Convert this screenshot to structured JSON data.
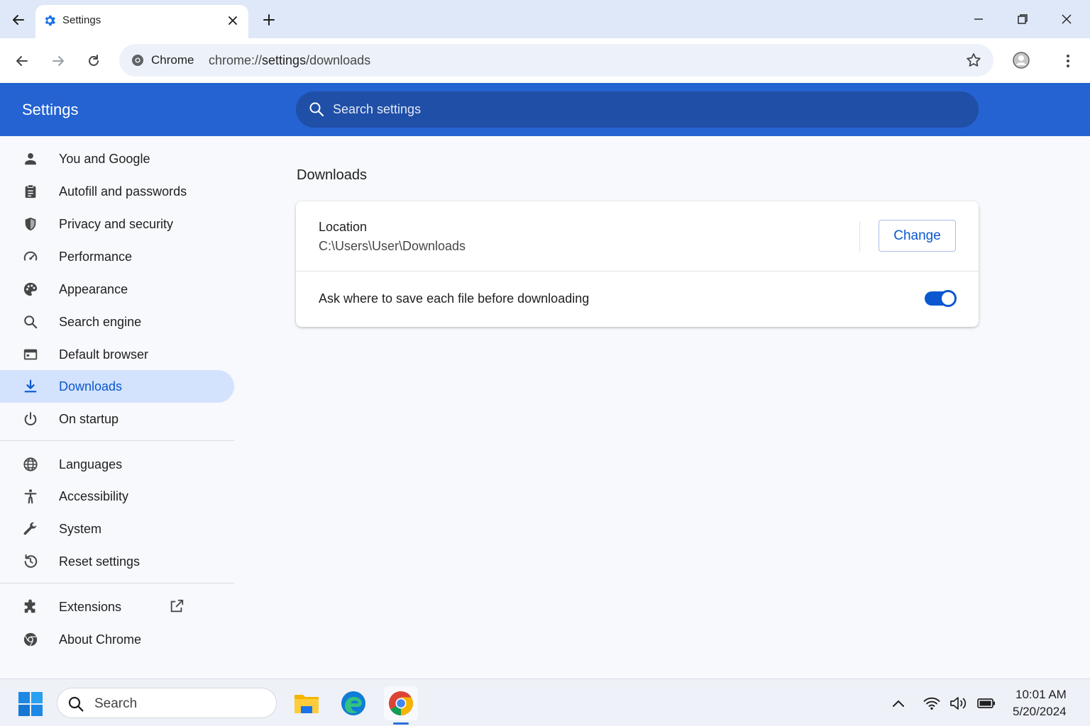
{
  "tab": {
    "title": "Settings"
  },
  "toolbar": {
    "chip": "Chrome",
    "url_scheme": "chrome://",
    "url_host": "settings",
    "url_path": "/downloads"
  },
  "header": {
    "title": "Settings",
    "search_placeholder": "Search settings"
  },
  "sidebar": {
    "items": [
      {
        "label": "You and Google",
        "icon": "person-icon"
      },
      {
        "label": "Autofill and passwords",
        "icon": "clipboard-icon"
      },
      {
        "label": "Privacy and security",
        "icon": "shield-icon"
      },
      {
        "label": "Performance",
        "icon": "speedometer-icon"
      },
      {
        "label": "Appearance",
        "icon": "palette-icon"
      },
      {
        "label": "Search engine",
        "icon": "search-icon"
      },
      {
        "label": "Default browser",
        "icon": "browser-icon"
      },
      {
        "label": "Downloads",
        "icon": "download-icon",
        "active": true
      },
      {
        "label": "On startup",
        "icon": "power-icon"
      },
      {
        "label": "Languages",
        "icon": "globe-icon"
      },
      {
        "label": "Accessibility",
        "icon": "accessibility-icon"
      },
      {
        "label": "System",
        "icon": "wrench-icon"
      },
      {
        "label": "Reset settings",
        "icon": "history-icon"
      },
      {
        "label": "Extensions",
        "icon": "puzzle-icon"
      },
      {
        "label": "About Chrome",
        "icon": "chrome-icon"
      }
    ]
  },
  "main": {
    "title": "Downloads",
    "location_label": "Location",
    "location_path": "C:\\Users\\User\\Downloads",
    "change_label": "Change",
    "ask_label": "Ask where to save each file before downloading",
    "ask_enabled": true
  },
  "taskbar": {
    "search_label": "Search",
    "time": "10:01 AM",
    "date": "5/20/2024"
  },
  "colors": {
    "accent": "#0b57d0",
    "header_bg": "#2463d1",
    "active_nav_bg": "#d3e3fd"
  }
}
